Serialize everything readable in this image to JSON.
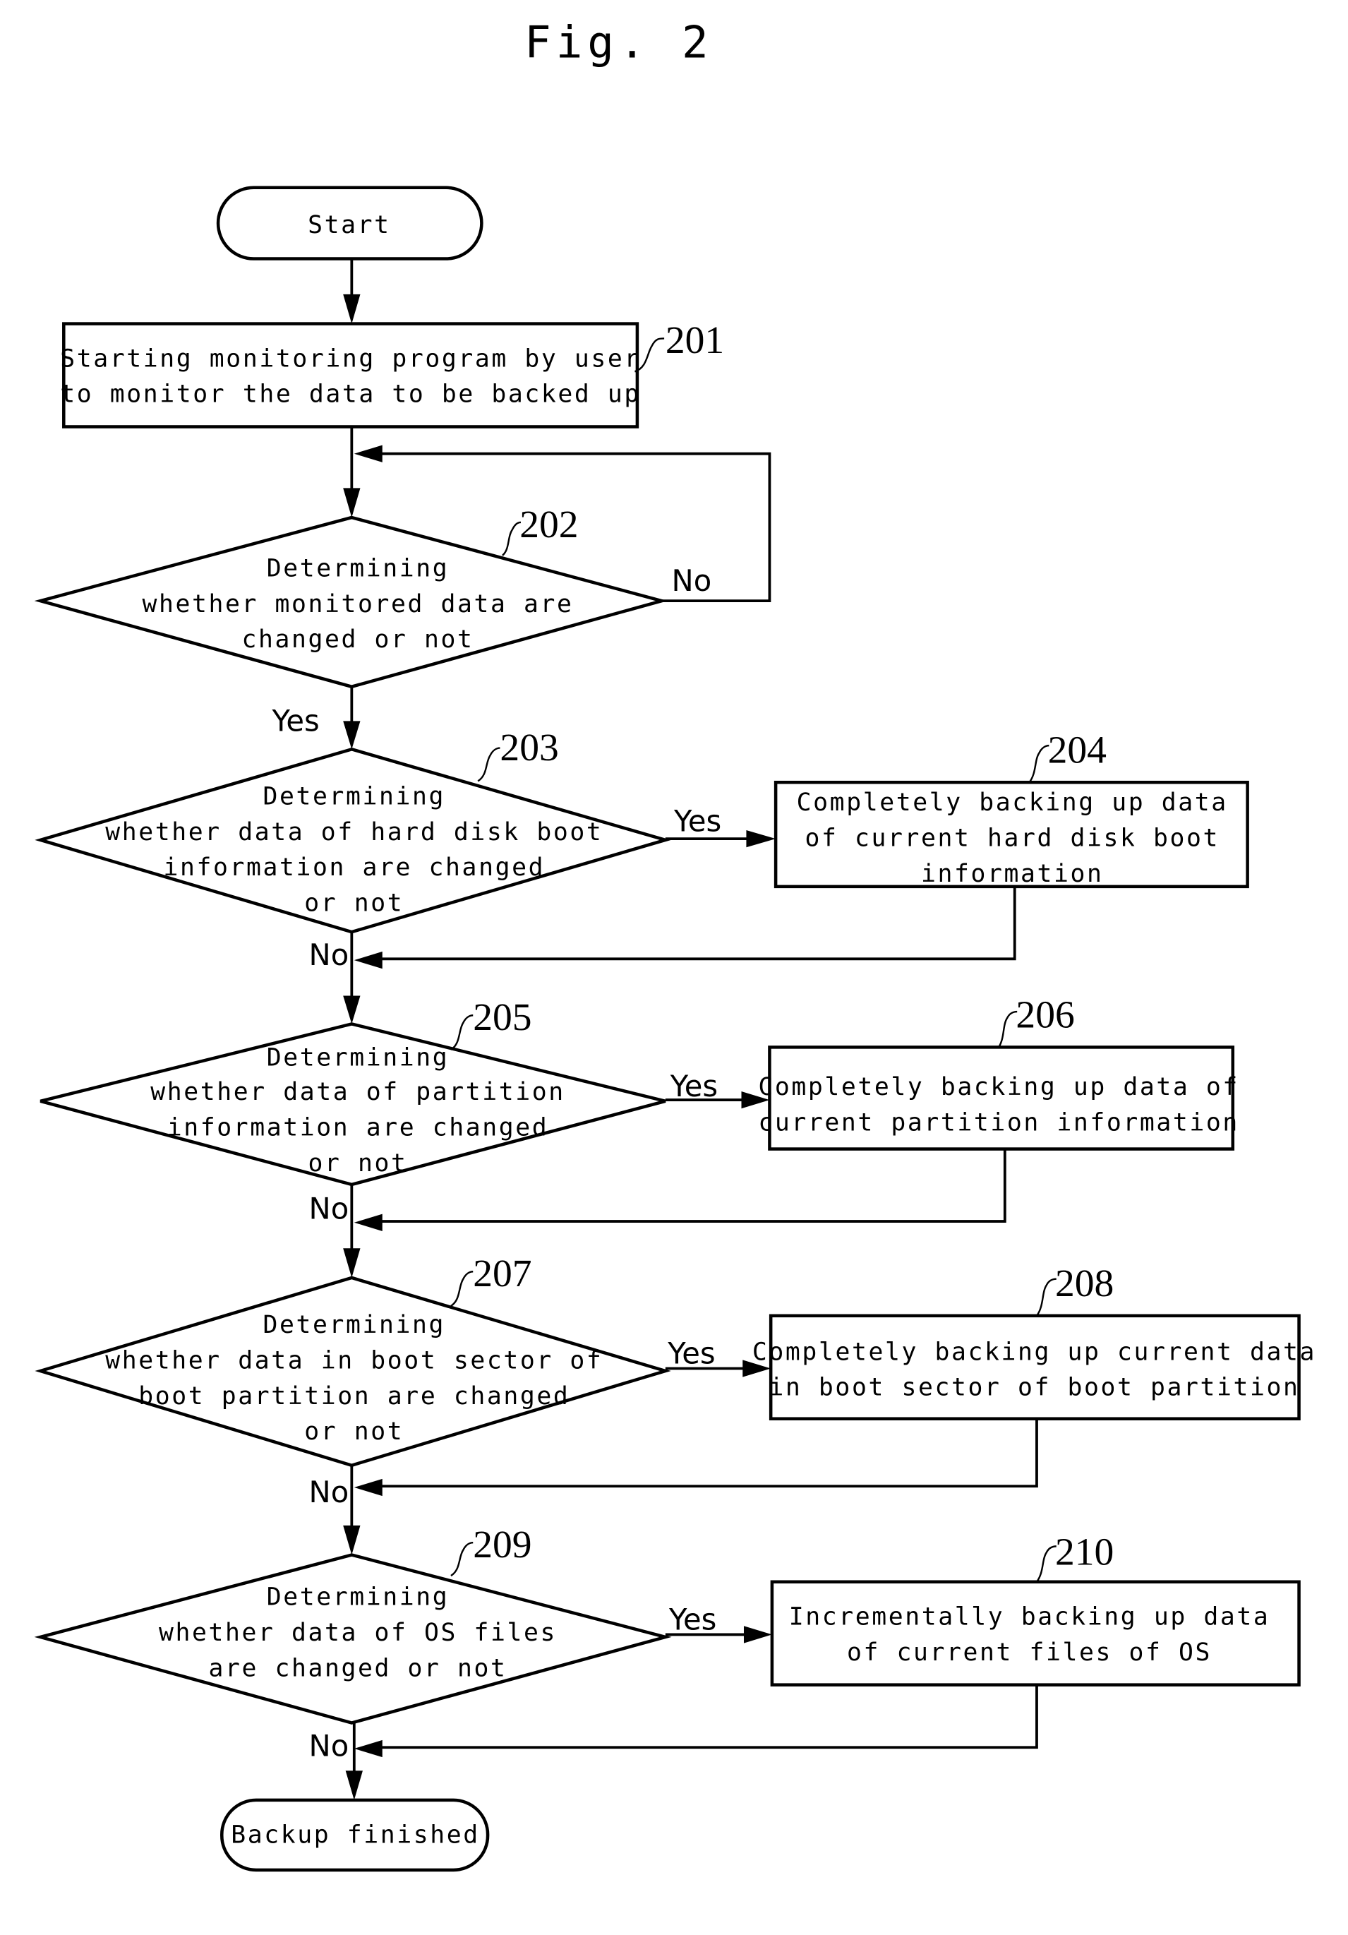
{
  "figure": {
    "title": "Fig. 2",
    "start_label": "Start",
    "end_label": "Backup finished"
  },
  "steps": {
    "s201": {
      "ref": "201",
      "lines": [
        "Starting monitoring program by user",
        "to monitor the data to be backed up"
      ]
    },
    "s202": {
      "ref": "202",
      "lines": [
        "Determining",
        "whether monitored data are",
        "changed or not"
      ]
    },
    "s203": {
      "ref": "203",
      "lines": [
        "Determining",
        "whether data of hard disk boot",
        "information are changed",
        "or not"
      ]
    },
    "s204": {
      "ref": "204",
      "lines": [
        "Completely backing up data",
        "of current hard disk boot",
        "information"
      ]
    },
    "s205": {
      "ref": "205",
      "lines": [
        "Determining",
        "whether data of partition",
        "information are changed",
        "or not"
      ]
    },
    "s206": {
      "ref": "206",
      "lines": [
        "Completely backing up data of",
        "current partition information"
      ]
    },
    "s207": {
      "ref": "207",
      "lines": [
        "Determining",
        "whether data in boot sector of",
        "boot partition are changed",
        "or not"
      ]
    },
    "s208": {
      "ref": "208",
      "lines": [
        "Completely backing up current data",
        "in boot sector of boot partition"
      ]
    },
    "s209": {
      "ref": "209",
      "lines": [
        "Determining",
        "whether data of OS files",
        "are changed or not"
      ]
    },
    "s210": {
      "ref": "210",
      "lines": [
        "Incrementally backing up data",
        "of current files of OS"
      ]
    }
  },
  "branch_labels": {
    "yes": "Yes",
    "no": "No"
  }
}
